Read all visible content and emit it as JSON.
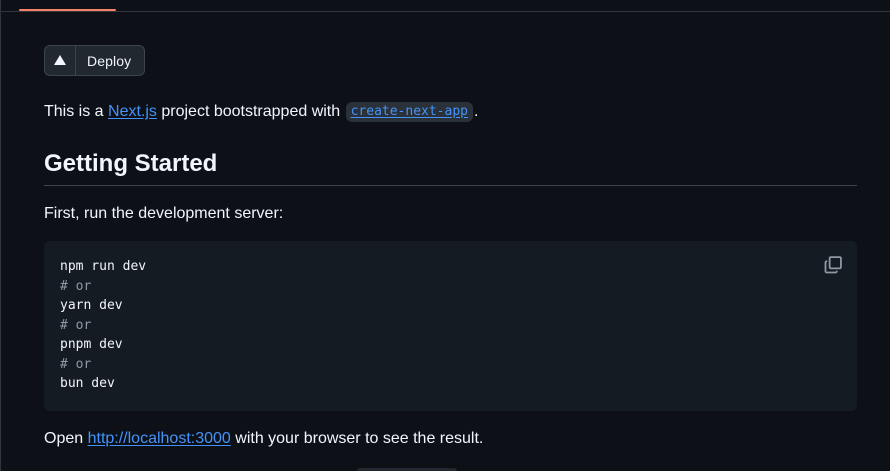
{
  "tabs": {
    "active_indicator_color": "#f78166"
  },
  "readme": {
    "deploy_button": {
      "label": "Deploy",
      "icon": "triangle-icon"
    },
    "intro": {
      "prefix": "This is a ",
      "link_text": "Next.js",
      "middle": " project bootstrapped with ",
      "code_text": "create-next-app",
      "suffix": "."
    },
    "getting_started_heading": "Getting Started",
    "first_run_text": "First, run the development server:",
    "code_block": {
      "copy_icon": "copy-icon",
      "lines": [
        "npm run dev",
        "# or",
        "yarn dev",
        "# or",
        "pnpm dev",
        "# or",
        "bun dev"
      ]
    },
    "open_line": {
      "prefix": "Open ",
      "link_text": "http://localhost:3000",
      "suffix": " with your browser to see the result."
    }
  },
  "colors": {
    "background": "#0d1117",
    "link": "#4493f8",
    "code_background": "#151b23",
    "border": "#3d444d"
  }
}
